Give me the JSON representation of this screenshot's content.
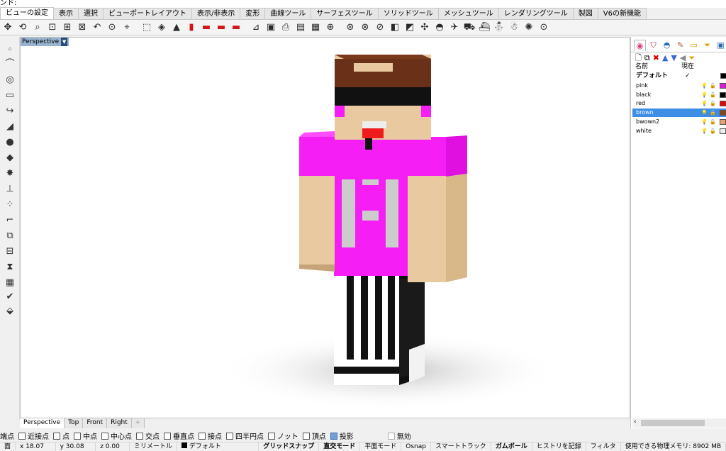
{
  "command_line": "ンド:",
  "menu_tabs": [
    "ビューの設定",
    "表示",
    "選択",
    "ビューポートレイアウト",
    "表示/非表示",
    "変形",
    "曲線ツール",
    "サーフェスツール",
    "ソリッドツール",
    "メッシュツール",
    "レンダリングツール",
    "製図",
    "V6の新機能"
  ],
  "toolbar_icons": [
    "pan-icon",
    "rotate-icon",
    "zoom-icon",
    "zoom-window-icon",
    "zoom-extents-icon",
    "zoom-selected-icon",
    "undo-view-icon",
    "zoom-target-icon",
    "named-view-icon",
    "sep",
    "perspective-icon",
    "set-camera-icon",
    "car-icon",
    "car-red-icon",
    "car-red2-icon",
    "car-red3-icon",
    "car-red4-icon",
    "sep",
    "set-cplane-icon",
    "capture-icon",
    "print-icon",
    "layout-icon",
    "cplane-icon",
    "magnify-icon",
    "sep",
    "target-icon",
    "target2-icon",
    "target3-icon",
    "object-props-icon",
    "render-icon",
    "gumball-icon",
    "cplane-top-icon",
    "airplane-icon",
    "vehicle-icon",
    "ship-icon",
    "walkabout-icon",
    "walk-icon",
    "light-icon",
    "osnap-icon"
  ],
  "viewport": {
    "title": "Perspective",
    "tabs": [
      "Perspective",
      "Top",
      "Front",
      "Right"
    ]
  },
  "osnap": {
    "items": [
      {
        "label": "端点",
        "checked": false,
        "partial": true
      },
      {
        "label": "近接点",
        "checked": false
      },
      {
        "label": "点",
        "checked": false
      },
      {
        "label": "中点",
        "checked": false
      },
      {
        "label": "中心点",
        "checked": false
      },
      {
        "label": "交点",
        "checked": false
      },
      {
        "label": "垂直点",
        "checked": false
      },
      {
        "label": "接点",
        "checked": false
      },
      {
        "label": "四半円点",
        "checked": false
      },
      {
        "label": "ノット",
        "checked": false
      },
      {
        "label": "頂点",
        "checked": false
      },
      {
        "label": "投影",
        "checked": true
      }
    ],
    "disable_label": "無効"
  },
  "status": {
    "cplane": "面",
    "x": "x 18.07",
    "y": "y 30.08",
    "z": "z 0.00",
    "unit": "ミリメートル",
    "layer": "デフォルト",
    "grid_snap": "グリッドスナップ",
    "ortho": "直交モード",
    "planar": "平面モード",
    "osnap": "Osnap",
    "smarttrack": "スマートトラック",
    "gumball": "ガムボール",
    "history": "ヒストリを記録",
    "filter": "フィルタ",
    "memory": "使用できる物理メモリ: 8902 MB"
  },
  "layers": {
    "header_name": "名前",
    "header_current": "現在",
    "default_name": "デフォルト",
    "rows": [
      {
        "name": "pink",
        "color": "#e612e6",
        "selected": false
      },
      {
        "name": "black",
        "color": "#000000",
        "selected": false
      },
      {
        "name": "red",
        "color": "#ee0000",
        "selected": false
      },
      {
        "name": "brown",
        "color": "#8b4513",
        "selected": true
      },
      {
        "name": "bwown2",
        "color": "#f0a070",
        "selected": false
      },
      {
        "name": "white",
        "color": "#f0f0f0",
        "selected": false
      }
    ]
  },
  "colors": {
    "magenta": "#f51ef5",
    "skin": "#e8c9a0",
    "hair": "#6b3018",
    "shirt_letter": "#cccccc"
  },
  "shirt_letter": "H"
}
